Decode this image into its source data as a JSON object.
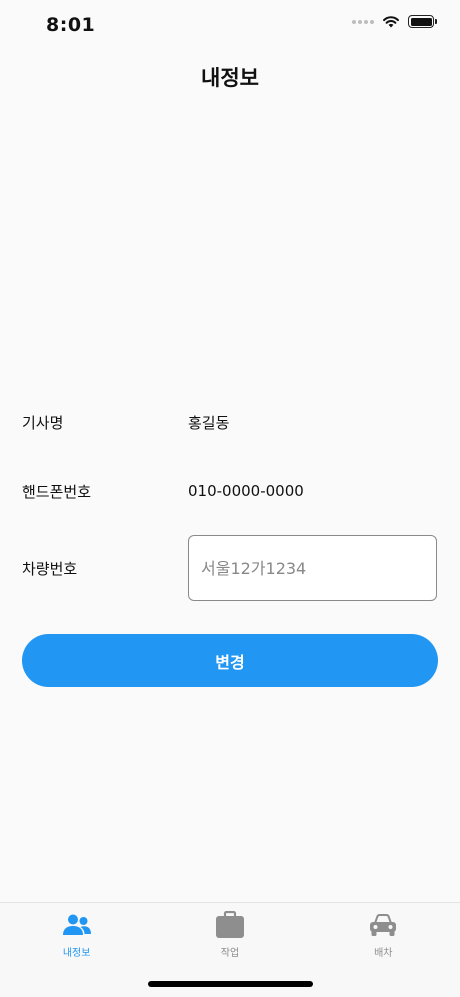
{
  "status_bar": {
    "time": "8:01"
  },
  "header": {
    "title": "내정보"
  },
  "form": {
    "driver_name_label": "기사명",
    "driver_name_value": "홍길동",
    "phone_label": "핸드폰번호",
    "phone_value": "010-0000-0000",
    "car_number_label": "차량번호",
    "car_number_placeholder": "서울12가1234",
    "car_number_value": ""
  },
  "actions": {
    "change_label": "변경"
  },
  "tab_bar": {
    "items": [
      {
        "label": "내정보",
        "icon": "people-icon",
        "active": true
      },
      {
        "label": "작업",
        "icon": "briefcase-icon",
        "active": false
      },
      {
        "label": "배차",
        "icon": "car-icon",
        "active": false
      }
    ]
  },
  "colors": {
    "accent": "#2196f3",
    "inactive": "#8e8e8e",
    "background": "#fafafa"
  }
}
